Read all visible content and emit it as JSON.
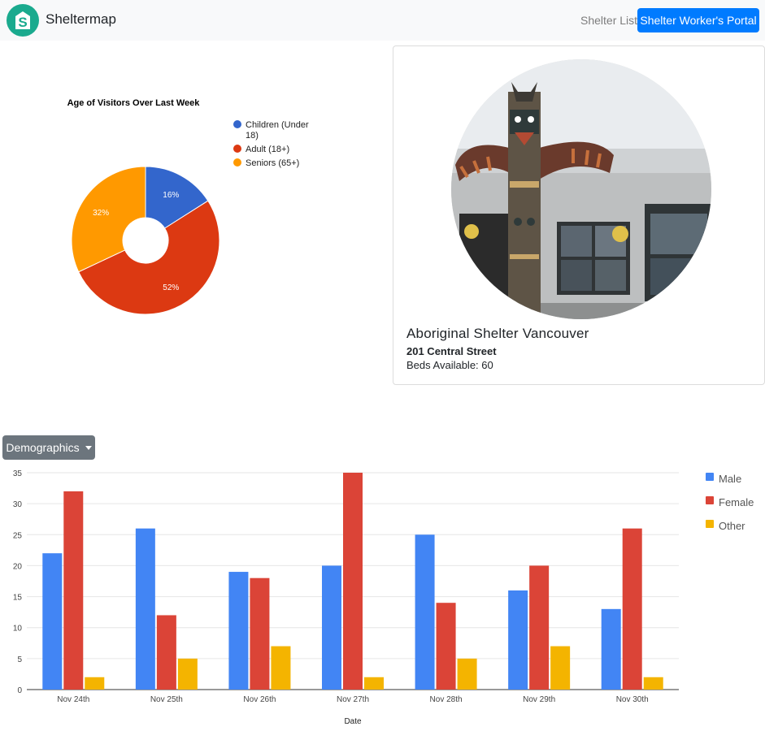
{
  "navbar": {
    "brand_letter": "S",
    "brand_name": "Sheltermap",
    "link_shelter_list": "Shelter List",
    "portal_button": "Shelter Worker's Portal"
  },
  "colors": {
    "brand": "#1aaa8e",
    "primary_button": "#007bff",
    "secondary_button": "#6c757d"
  },
  "shelter": {
    "name": "Aboriginal Shelter Vancouver",
    "address": "201 Central Street",
    "beds_label": "Beds Available:",
    "beds_value": "60"
  },
  "demographics_dropdown": {
    "label": "Demographics"
  },
  "chart_data": [
    {
      "type": "pie",
      "title": "Age of Visitors Over Last Week",
      "donut": true,
      "legend_position": "right",
      "slices": [
        {
          "label": "Children (Under 18)",
          "legend_lines": [
            "Children (Under",
            "18)"
          ],
          "value": 16,
          "color": "#3366cc",
          "display": "16%"
        },
        {
          "label": "Adult (18+)",
          "legend_lines": [
            "Adult (18+)"
          ],
          "value": 52,
          "color": "#dc3912",
          "display": "52%"
        },
        {
          "label": "Seniors (65+)",
          "legend_lines": [
            "Seniors (65+)"
          ],
          "value": 32,
          "color": "#ff9900",
          "display": "32%"
        }
      ]
    },
    {
      "type": "bar",
      "xlabel": "Date",
      "ylabel": "",
      "ylim": [
        0,
        35
      ],
      "yticks": [
        0,
        5,
        10,
        15,
        20,
        25,
        30,
        35
      ],
      "grid": true,
      "legend_position": "right",
      "categories": [
        "Nov 24th",
        "Nov 25th",
        "Nov 26th",
        "Nov 27th",
        "Nov 28th",
        "Nov 29th",
        "Nov 30th"
      ],
      "series": [
        {
          "name": "Male",
          "color": "#4285f4",
          "values": [
            22,
            26,
            19,
            20,
            25,
            16,
            13
          ]
        },
        {
          "name": "Female",
          "color": "#db4437",
          "values": [
            32,
            12,
            18,
            35,
            14,
            20,
            26
          ]
        },
        {
          "name": "Other",
          "color": "#f4b400",
          "values": [
            2,
            5,
            7,
            2,
            5,
            7,
            2
          ]
        }
      ]
    }
  ]
}
